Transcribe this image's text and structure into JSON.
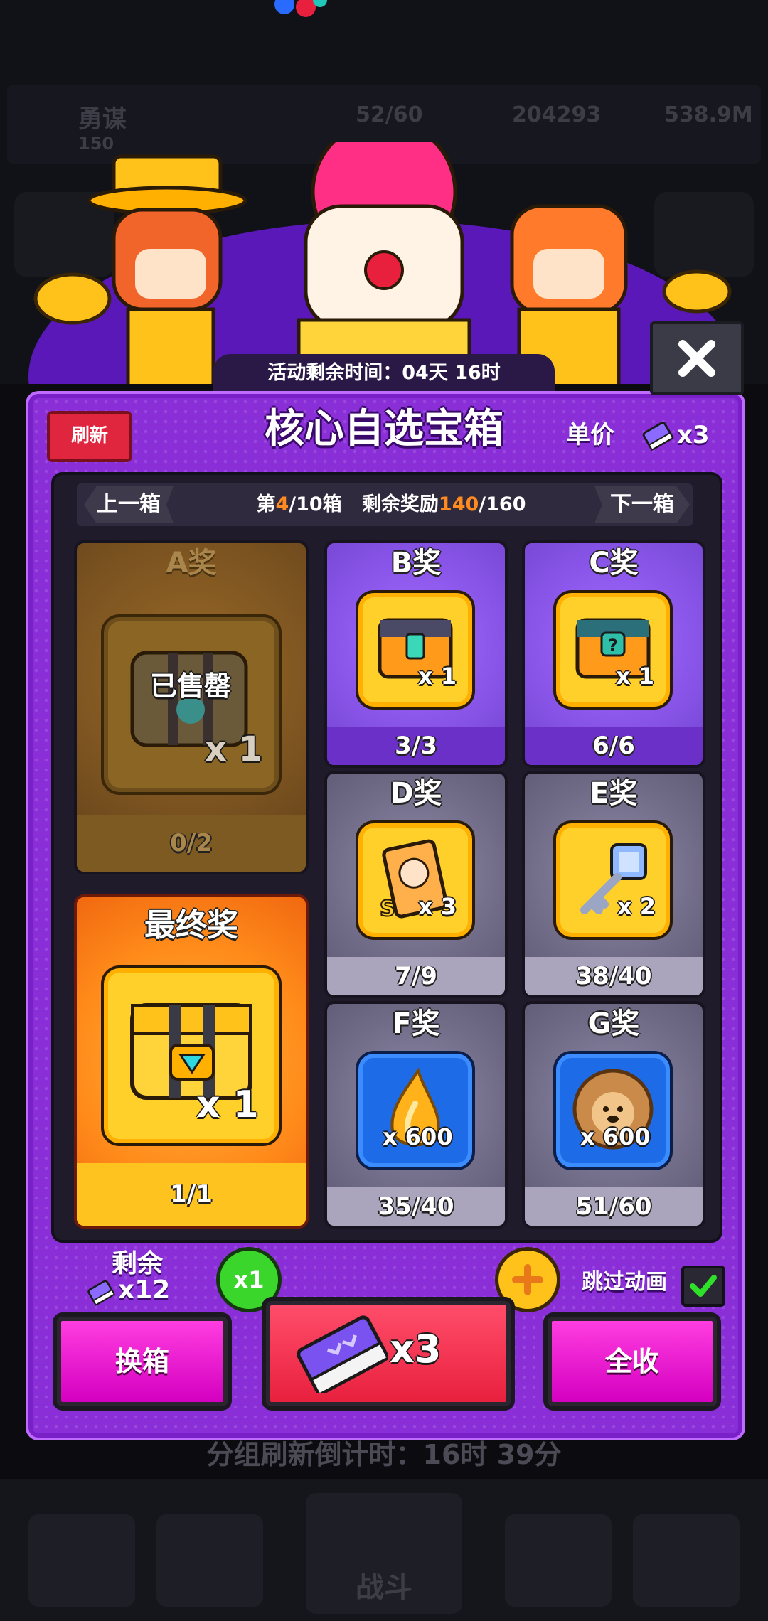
{
  "event": {
    "time_left": "活动剩余时间：04天 16时"
  },
  "background": {
    "player_name": "勇谋",
    "player_level": "150",
    "energy": "52/60",
    "currency_1": "204293",
    "currency_2": "538.9M",
    "battle_label": "战斗"
  },
  "panel": {
    "refresh_label": "刷新",
    "title": "核心自选宝箱",
    "unit_price_label": "单价",
    "unit_price_mult": "x3",
    "prev_label": "上一箱",
    "next_label": "下一箱",
    "box_prefix": "第",
    "box_current": "4",
    "box_suffix": "/10箱",
    "reward_label": "剩余奖励",
    "reward_current": "140",
    "reward_total": "/160"
  },
  "prizes": [
    {
      "name": "A奖",
      "status": "已售罄",
      "qty": "x 1",
      "count": "0/2",
      "icon": "chest-diamond-icon"
    },
    {
      "name": "B奖",
      "qty": "x 1",
      "count": "3/3",
      "icon": "chest-gem-icon"
    },
    {
      "name": "C奖",
      "qty": "x 1",
      "count": "6/6",
      "icon": "chest-question-icon"
    },
    {
      "name": "D奖",
      "qty": "x 3",
      "count": "7/9",
      "icon": "hero-card-icon"
    },
    {
      "name": "E奖",
      "qty": "x 2",
      "count": "38/40",
      "icon": "key-icon"
    },
    {
      "name": "F奖",
      "qty": "x 600",
      "count": "35/40",
      "icon": "flame-essence-icon"
    },
    {
      "name": "G奖",
      "qty": "x 600",
      "count": "51/60",
      "icon": "pet-food-icon"
    }
  ],
  "final_prize": {
    "name": "最终奖",
    "qty": "x 1",
    "count": "1/1",
    "icon": "chest-diamond-icon"
  },
  "controls": {
    "remaining_label": "剩余",
    "remaining_value": "x12",
    "draw_count": "x1",
    "skip_animation_label": "跳过动画",
    "skip_animation_checked": true,
    "swap_box_label": "换箱",
    "draw_cost": "x3",
    "collect_all_label": "全收"
  },
  "footer": {
    "refresh_countdown": "分组刷新倒计时：16时 39分"
  },
  "colors": {
    "panel": "#8a2fd8",
    "accent_orange": "#ff8a1f",
    "button_magenta": "#e81ad0",
    "button_red": "#f0304e"
  }
}
